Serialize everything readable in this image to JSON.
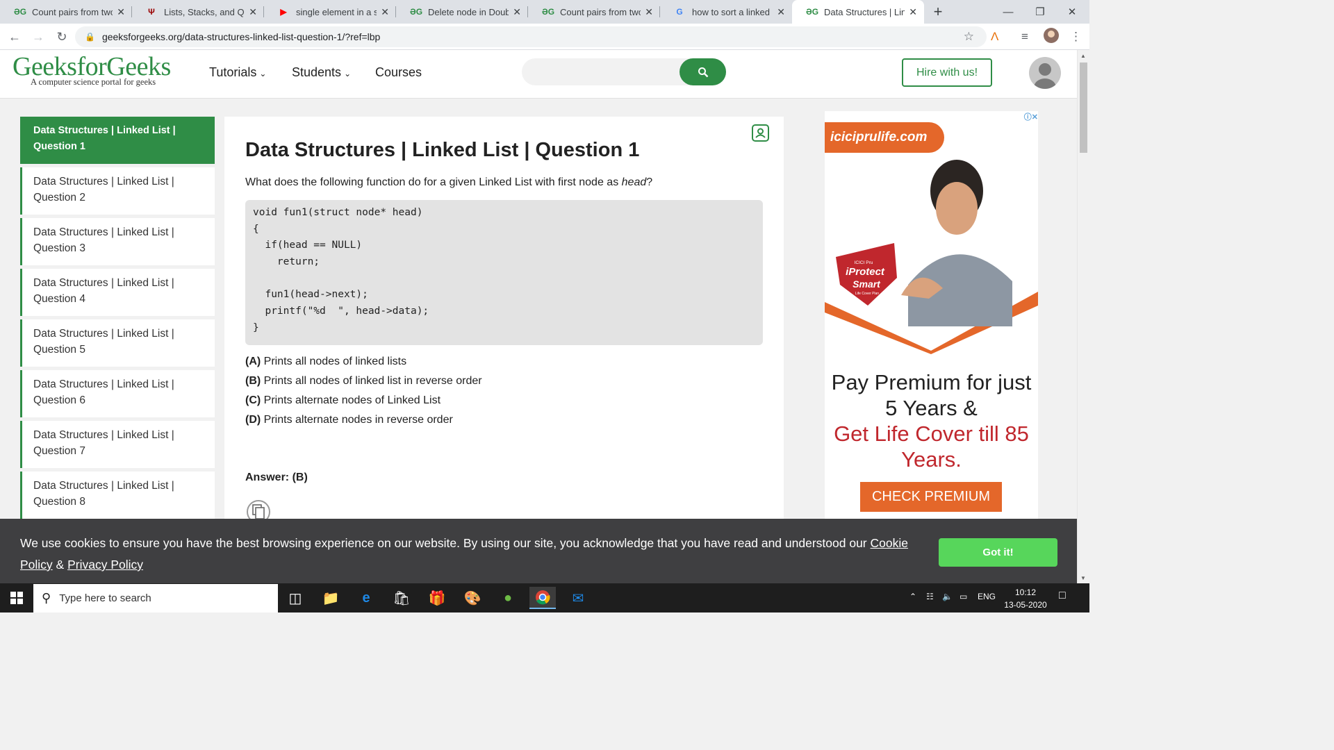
{
  "browser": {
    "tabs": [
      {
        "icon": "gfg-icon",
        "favicon": "ƏG",
        "title": "Count pairs from two li",
        "active": false
      },
      {
        "icon": "iu-icon",
        "favicon": "Ψ",
        "title": "Lists, Stacks, and Queue",
        "active": false
      },
      {
        "icon": "youtube-icon",
        "favicon": "▶",
        "title": "single element in a sort",
        "active": false
      },
      {
        "icon": "gfg-icon",
        "favicon": "ƏG",
        "title": "Delete node in Doubly",
        "active": false
      },
      {
        "icon": "gfg-icon",
        "favicon": "ƏG",
        "title": "Count pairs from two li",
        "active": false
      },
      {
        "icon": "google-icon",
        "favicon": "G",
        "title": "how to sort a linked list",
        "active": false
      },
      {
        "icon": "gfg-icon",
        "favicon": "ƏG",
        "title": "Data Structures | Linked",
        "active": true
      }
    ],
    "url": "geeksforgeeks.org/data-structures-linked-list-question-1/?ref=lbp",
    "accent": "#dee1e6"
  },
  "site": {
    "logo": "GeeksforGeeks",
    "tagline": "A computer science portal for geeks",
    "nav": [
      "Tutorials",
      "Students",
      "Courses"
    ],
    "search_placeholder": "",
    "hire_label": "Hire with us!",
    "brand_color": "#2f8d46"
  },
  "sidebar": {
    "items": [
      {
        "line1": "Data Structures | Linked List |",
        "line2": "Question 1",
        "active": true
      },
      {
        "line1": "Data Structures | Linked List |",
        "line2": "Question 2",
        "active": false
      },
      {
        "line1": "Data Structures | Linked List |",
        "line2": "Question 3",
        "active": false
      },
      {
        "line1": "Data Structures | Linked List |",
        "line2": "Question 4",
        "active": false
      },
      {
        "line1": "Data Structures | Linked List |",
        "line2": "Question 5",
        "active": false
      },
      {
        "line1": "Data Structures | Linked List |",
        "line2": "Question 6",
        "active": false
      },
      {
        "line1": "Data Structures | Linked List |",
        "line2": "Question 7",
        "active": false
      },
      {
        "line1": "Data Structures | Linked List |",
        "line2": "Question 8",
        "active": false
      }
    ]
  },
  "article": {
    "title": "Data Structures | Linked List | Question 1",
    "question_prefix": "What does the following function do for a given Linked List with first node as ",
    "question_emph": "head",
    "question_suffix": "?",
    "code": [
      "void fun1(struct node* head)",
      "{",
      "  if(head == NULL)",
      "    return;",
      "",
      "  fun1(head->next);",
      "  printf(\"%d  \", head->data);",
      "}"
    ],
    "options": [
      {
        "key": "(A)",
        "text": " Prints all nodes of linked lists"
      },
      {
        "key": "(B)",
        "text": " Prints all nodes of linked list in reverse order"
      },
      {
        "key": "(C)",
        "text": " Prints alternate nodes of Linked List"
      },
      {
        "key": "(D)",
        "text": " Prints alternate nodes in reverse order"
      }
    ],
    "answer": "Answer: (B)"
  },
  "ad": {
    "brand": "iciciprulife.com",
    "badge1": "ICICI Pru",
    "badge2": "iProtect",
    "badge3": "Smart",
    "badge4": "Life Cover Plan",
    "headline1": "Pay Premium for just 5 Years &",
    "headline2": "Get Life Cover till 85 Years.",
    "cta": "CHECK PREMIUM",
    "accent": "#e4672a"
  },
  "cookie": {
    "text": "We use cookies to ensure you have the best browsing experience on our website. By using our site, you acknowledge that you have read and understood our ",
    "cookie_link": "Cookie Policy",
    "amp": " & ",
    "privacy_link": "Privacy Policy",
    "button": "Got it!"
  },
  "taskbar": {
    "search_placeholder": "Type here to search",
    "language": "ENG",
    "time": "10:12",
    "date": "13-05-2020"
  }
}
